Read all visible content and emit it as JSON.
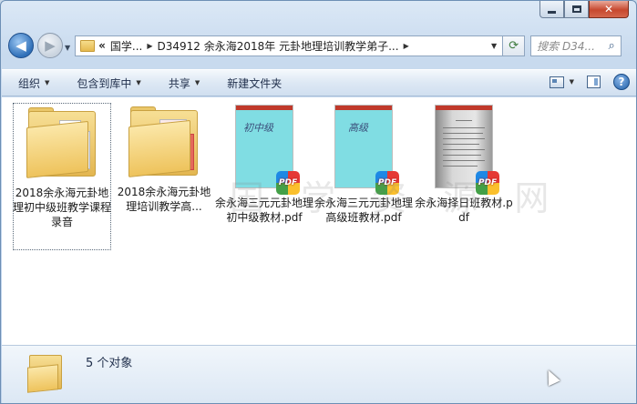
{
  "window": {
    "caption_buttons": {
      "close_glyph": "✕"
    }
  },
  "nav": {
    "back_glyph": "◀",
    "forward_glyph": "▶",
    "address_overflow": "«",
    "breadcrumb": [
      "国学...",
      "D34912 余永海2018年 元卦地理培训教学弟子..."
    ],
    "search_placeholder": "搜索 D34...",
    "search_icon": "search-icon"
  },
  "toolbar": {
    "items": [
      {
        "label": "组织",
        "has_menu": true
      },
      {
        "label": "包含到库中",
        "has_menu": true
      },
      {
        "label": "共享",
        "has_menu": true
      },
      {
        "label": "新建文件夹",
        "has_menu": false
      }
    ],
    "help_glyph": "?"
  },
  "files": [
    {
      "name": "2018余永海元卦地理初中级班教学课程录音",
      "kind": "folder",
      "selected": true
    },
    {
      "name": "2018余永海元卦地理培训教学高...",
      "kind": "folder",
      "selected": false
    },
    {
      "name": "余永海三元元卦地理初中级教材.pdf",
      "kind": "pdf",
      "thumb_text": "初中级",
      "selected": false
    },
    {
      "name": "余永海三元元卦地理高级班教材.pdf",
      "kind": "pdf",
      "thumb_text": "高级",
      "selected": false
    },
    {
      "name": "余永海择日班教材.pdf",
      "kind": "pdf",
      "thumb_text": "",
      "selected": false
    }
  ],
  "watermark": "国 学 资 源 网",
  "status": {
    "text": "5 个对象"
  },
  "colors": {
    "accent": "#2f6fb8",
    "pdf_bar": "#c0392b",
    "folder": "#e3b651",
    "pdf_page": "#80dde3"
  }
}
